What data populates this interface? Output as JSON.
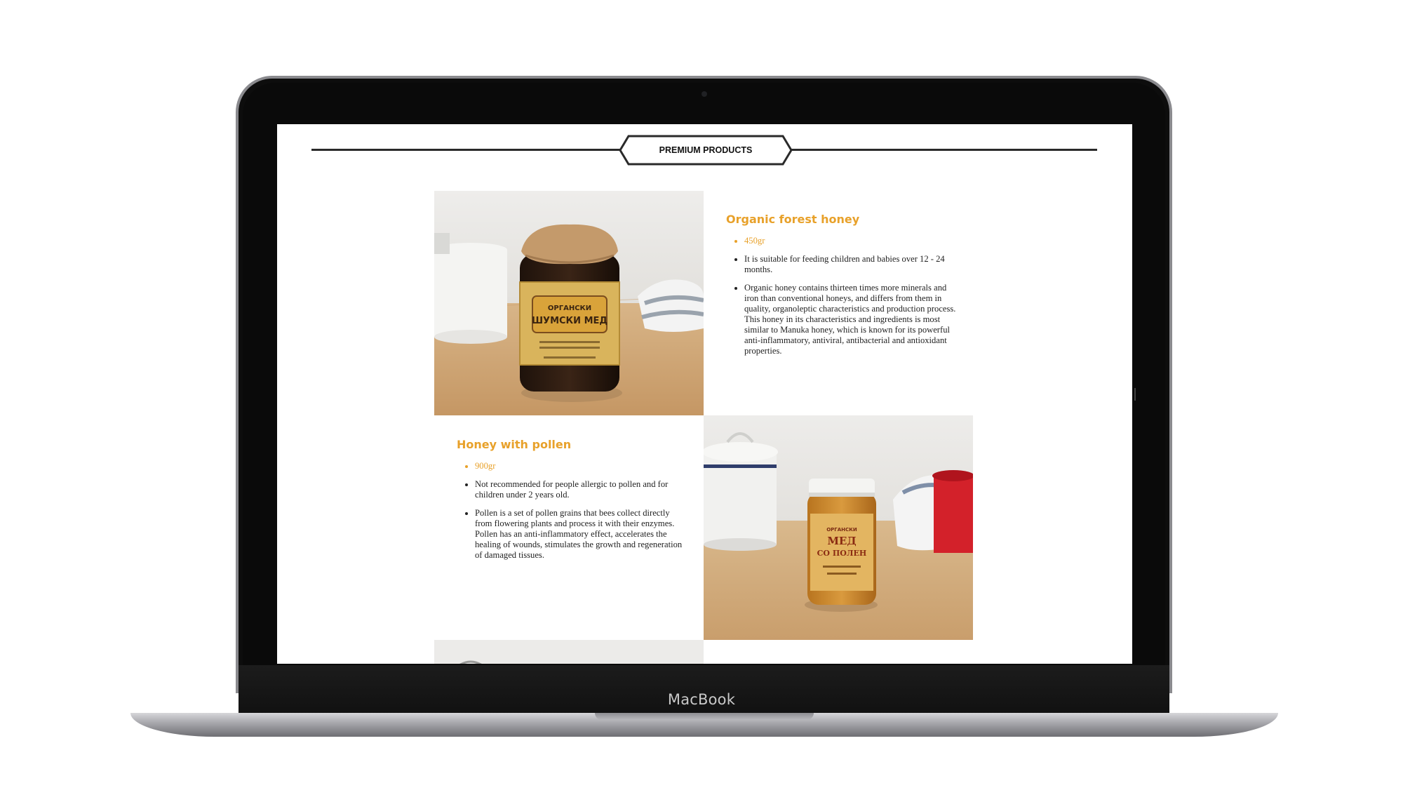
{
  "device": {
    "brand_label": "MacBook"
  },
  "section": {
    "title": "PREMIUM PRODUCTS"
  },
  "products": [
    {
      "name": "Organic forest honey",
      "weight": "450gr",
      "bullets": [
        "It is suitable for feeding children and babies over 12 - 24 months.",
        "Organic honey contains thirteen times more minerals and iron than conventional honeys, and differs from them in quality, organoleptic characteristics and production process. This honey in its characteristics and ingredients is most similar to Manuka honey, which is known for its powerful anti-inflammatory, antiviral, antibacterial and antioxidant properties."
      ],
      "label_lines": [
        "ОРГАНСКИ",
        "ШУМСКИ МЕД"
      ]
    },
    {
      "name": "Honey with pollen",
      "weight": "900gr",
      "bullets": [
        "Not recommended for people allergic to pollen and for children under 2 years old.",
        "Pollen is a set of pollen grains that bees collect directly from flowering plants and process it with their enzymes. Pollen has an anti-inflammatory effect, accelerates the healing of wounds, stimulates the growth and regeneration of damaged tissues."
      ],
      "label_lines": [
        "ОРГАНСКИ",
        "МЕД",
        "СО ПОЛЕН"
      ]
    }
  ],
  "colors": {
    "accent": "#e8a12a",
    "text": "#222222",
    "frame": "#0d0d0d"
  }
}
